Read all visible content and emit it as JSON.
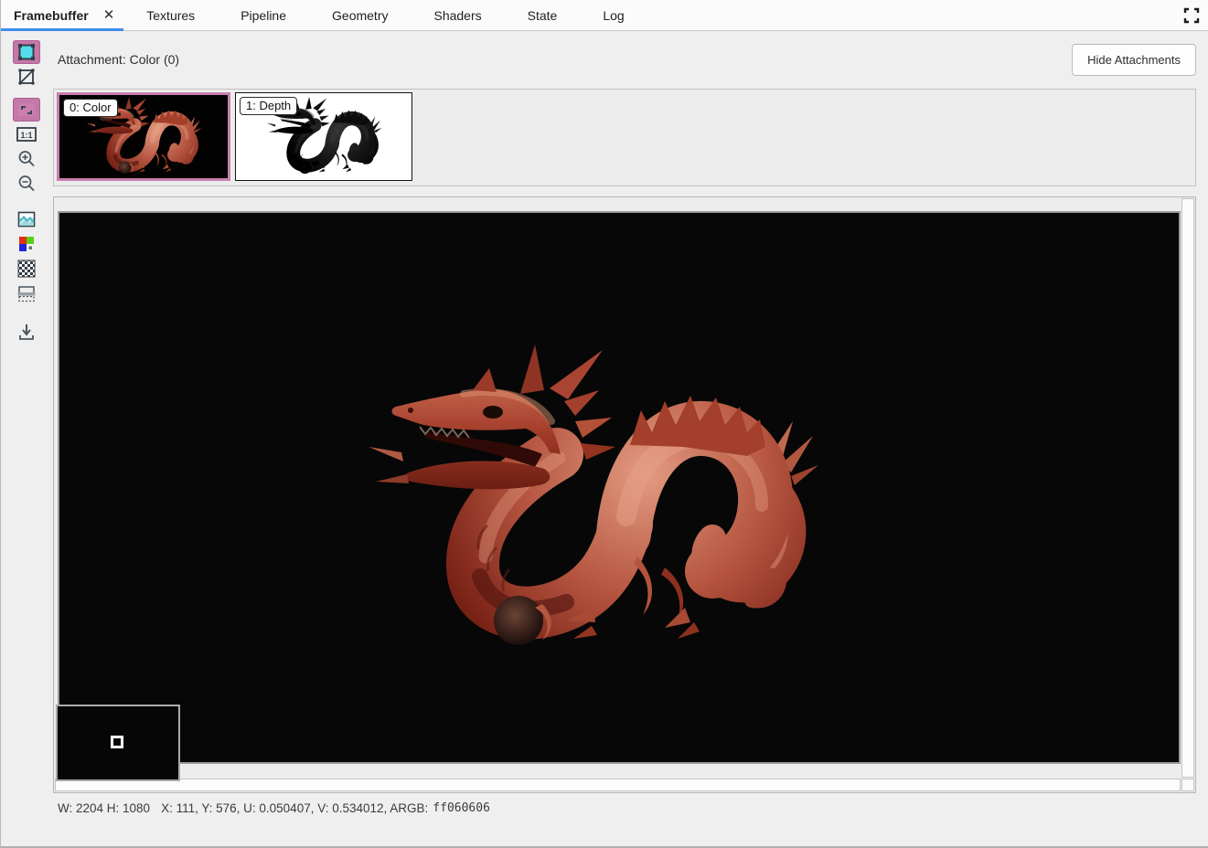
{
  "tabs": {
    "items": [
      {
        "label": "Framebuffer",
        "active": true
      },
      {
        "label": "Textures",
        "active": false
      },
      {
        "label": "Pipeline",
        "active": false
      },
      {
        "label": "Geometry",
        "active": false
      },
      {
        "label": "Shaders",
        "active": false
      },
      {
        "label": "State",
        "active": false
      },
      {
        "label": "Log",
        "active": false
      }
    ],
    "close_glyph": "✕"
  },
  "toolbar": {
    "actual_size_glyph": "1:1",
    "buttons": [
      {
        "name": "display-solid-color",
        "active": true
      },
      {
        "name": "display-wireframe",
        "active": false
      },
      {
        "name": "fit-to-window",
        "active": true
      },
      {
        "name": "actual-size",
        "active": false
      },
      {
        "name": "zoom-in",
        "active": false
      },
      {
        "name": "zoom-out",
        "active": false
      },
      {
        "name": "background-image",
        "active": false
      },
      {
        "name": "rgba-channels",
        "active": false
      },
      {
        "name": "checkerboard-background",
        "active": false
      },
      {
        "name": "split-range",
        "active": false
      },
      {
        "name": "save-image",
        "active": false
      }
    ]
  },
  "attachments": {
    "label": "Attachment: Color (0)",
    "hide_button_label": "Hide Attachments",
    "thumbnails": [
      {
        "label": "0: Color",
        "selected": true
      },
      {
        "label": "1: Depth",
        "selected": false
      }
    ]
  },
  "statusbar": {
    "dimensions": "W: 2204 H: 1080",
    "pixel_info": "X: 111, Y: 576, U: 0.050407, V: 0.534012, ARGB:",
    "argb_value": "ff060606"
  },
  "colors": {
    "accent_blue": "#3d8eed",
    "selection_pink": "#c77fad",
    "toolbar_highlight_pink": "#c478a7",
    "icon_cyan": "#55dbe9",
    "viewport_black": "#070707",
    "dragon_red": "#a8432f",
    "status_hex_color": "#3b3b3b"
  }
}
